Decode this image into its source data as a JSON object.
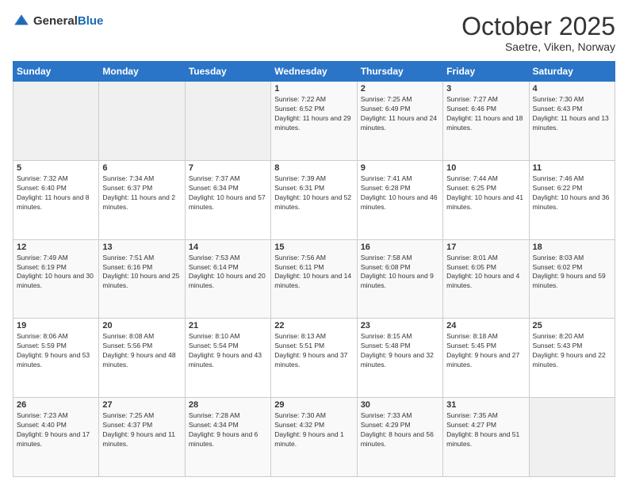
{
  "header": {
    "logo_general": "General",
    "logo_blue": "Blue",
    "title": "October 2025",
    "subtitle": "Saetre, Viken, Norway"
  },
  "calendar": {
    "days_of_week": [
      "Sunday",
      "Monday",
      "Tuesday",
      "Wednesday",
      "Thursday",
      "Friday",
      "Saturday"
    ],
    "weeks": [
      [
        {
          "day": "",
          "sunrise": "",
          "sunset": "",
          "daylight": ""
        },
        {
          "day": "",
          "sunrise": "",
          "sunset": "",
          "daylight": ""
        },
        {
          "day": "",
          "sunrise": "",
          "sunset": "",
          "daylight": ""
        },
        {
          "day": "1",
          "sunrise": "Sunrise: 7:22 AM",
          "sunset": "Sunset: 6:52 PM",
          "daylight": "Daylight: 11 hours and 29 minutes."
        },
        {
          "day": "2",
          "sunrise": "Sunrise: 7:25 AM",
          "sunset": "Sunset: 6:49 PM",
          "daylight": "Daylight: 11 hours and 24 minutes."
        },
        {
          "day": "3",
          "sunrise": "Sunrise: 7:27 AM",
          "sunset": "Sunset: 6:46 PM",
          "daylight": "Daylight: 11 hours and 18 minutes."
        },
        {
          "day": "4",
          "sunrise": "Sunrise: 7:30 AM",
          "sunset": "Sunset: 6:43 PM",
          "daylight": "Daylight: 11 hours and 13 minutes."
        }
      ],
      [
        {
          "day": "5",
          "sunrise": "Sunrise: 7:32 AM",
          "sunset": "Sunset: 6:40 PM",
          "daylight": "Daylight: 11 hours and 8 minutes."
        },
        {
          "day": "6",
          "sunrise": "Sunrise: 7:34 AM",
          "sunset": "Sunset: 6:37 PM",
          "daylight": "Daylight: 11 hours and 2 minutes."
        },
        {
          "day": "7",
          "sunrise": "Sunrise: 7:37 AM",
          "sunset": "Sunset: 6:34 PM",
          "daylight": "Daylight: 10 hours and 57 minutes."
        },
        {
          "day": "8",
          "sunrise": "Sunrise: 7:39 AM",
          "sunset": "Sunset: 6:31 PM",
          "daylight": "Daylight: 10 hours and 52 minutes."
        },
        {
          "day": "9",
          "sunrise": "Sunrise: 7:41 AM",
          "sunset": "Sunset: 6:28 PM",
          "daylight": "Daylight: 10 hours and 46 minutes."
        },
        {
          "day": "10",
          "sunrise": "Sunrise: 7:44 AM",
          "sunset": "Sunset: 6:25 PM",
          "daylight": "Daylight: 10 hours and 41 minutes."
        },
        {
          "day": "11",
          "sunrise": "Sunrise: 7:46 AM",
          "sunset": "Sunset: 6:22 PM",
          "daylight": "Daylight: 10 hours and 36 minutes."
        }
      ],
      [
        {
          "day": "12",
          "sunrise": "Sunrise: 7:49 AM",
          "sunset": "Sunset: 6:19 PM",
          "daylight": "Daylight: 10 hours and 30 minutes."
        },
        {
          "day": "13",
          "sunrise": "Sunrise: 7:51 AM",
          "sunset": "Sunset: 6:16 PM",
          "daylight": "Daylight: 10 hours and 25 minutes."
        },
        {
          "day": "14",
          "sunrise": "Sunrise: 7:53 AM",
          "sunset": "Sunset: 6:14 PM",
          "daylight": "Daylight: 10 hours and 20 minutes."
        },
        {
          "day": "15",
          "sunrise": "Sunrise: 7:56 AM",
          "sunset": "Sunset: 6:11 PM",
          "daylight": "Daylight: 10 hours and 14 minutes."
        },
        {
          "day": "16",
          "sunrise": "Sunrise: 7:58 AM",
          "sunset": "Sunset: 6:08 PM",
          "daylight": "Daylight: 10 hours and 9 minutes."
        },
        {
          "day": "17",
          "sunrise": "Sunrise: 8:01 AM",
          "sunset": "Sunset: 6:05 PM",
          "daylight": "Daylight: 10 hours and 4 minutes."
        },
        {
          "day": "18",
          "sunrise": "Sunrise: 8:03 AM",
          "sunset": "Sunset: 6:02 PM",
          "daylight": "Daylight: 9 hours and 59 minutes."
        }
      ],
      [
        {
          "day": "19",
          "sunrise": "Sunrise: 8:06 AM",
          "sunset": "Sunset: 5:59 PM",
          "daylight": "Daylight: 9 hours and 53 minutes."
        },
        {
          "day": "20",
          "sunrise": "Sunrise: 8:08 AM",
          "sunset": "Sunset: 5:56 PM",
          "daylight": "Daylight: 9 hours and 48 minutes."
        },
        {
          "day": "21",
          "sunrise": "Sunrise: 8:10 AM",
          "sunset": "Sunset: 5:54 PM",
          "daylight": "Daylight: 9 hours and 43 minutes."
        },
        {
          "day": "22",
          "sunrise": "Sunrise: 8:13 AM",
          "sunset": "Sunset: 5:51 PM",
          "daylight": "Daylight: 9 hours and 37 minutes."
        },
        {
          "day": "23",
          "sunrise": "Sunrise: 8:15 AM",
          "sunset": "Sunset: 5:48 PM",
          "daylight": "Daylight: 9 hours and 32 minutes."
        },
        {
          "day": "24",
          "sunrise": "Sunrise: 8:18 AM",
          "sunset": "Sunset: 5:45 PM",
          "daylight": "Daylight: 9 hours and 27 minutes."
        },
        {
          "day": "25",
          "sunrise": "Sunrise: 8:20 AM",
          "sunset": "Sunset: 5:43 PM",
          "daylight": "Daylight: 9 hours and 22 minutes."
        }
      ],
      [
        {
          "day": "26",
          "sunrise": "Sunrise: 7:23 AM",
          "sunset": "Sunset: 4:40 PM",
          "daylight": "Daylight: 9 hours and 17 minutes."
        },
        {
          "day": "27",
          "sunrise": "Sunrise: 7:25 AM",
          "sunset": "Sunset: 4:37 PM",
          "daylight": "Daylight: 9 hours and 11 minutes."
        },
        {
          "day": "28",
          "sunrise": "Sunrise: 7:28 AM",
          "sunset": "Sunset: 4:34 PM",
          "daylight": "Daylight: 9 hours and 6 minutes."
        },
        {
          "day": "29",
          "sunrise": "Sunrise: 7:30 AM",
          "sunset": "Sunset: 4:32 PM",
          "daylight": "Daylight: 9 hours and 1 minute."
        },
        {
          "day": "30",
          "sunrise": "Sunrise: 7:33 AM",
          "sunset": "Sunset: 4:29 PM",
          "daylight": "Daylight: 8 hours and 56 minutes."
        },
        {
          "day": "31",
          "sunrise": "Sunrise: 7:35 AM",
          "sunset": "Sunset: 4:27 PM",
          "daylight": "Daylight: 8 hours and 51 minutes."
        },
        {
          "day": "",
          "sunrise": "",
          "sunset": "",
          "daylight": ""
        }
      ]
    ]
  }
}
